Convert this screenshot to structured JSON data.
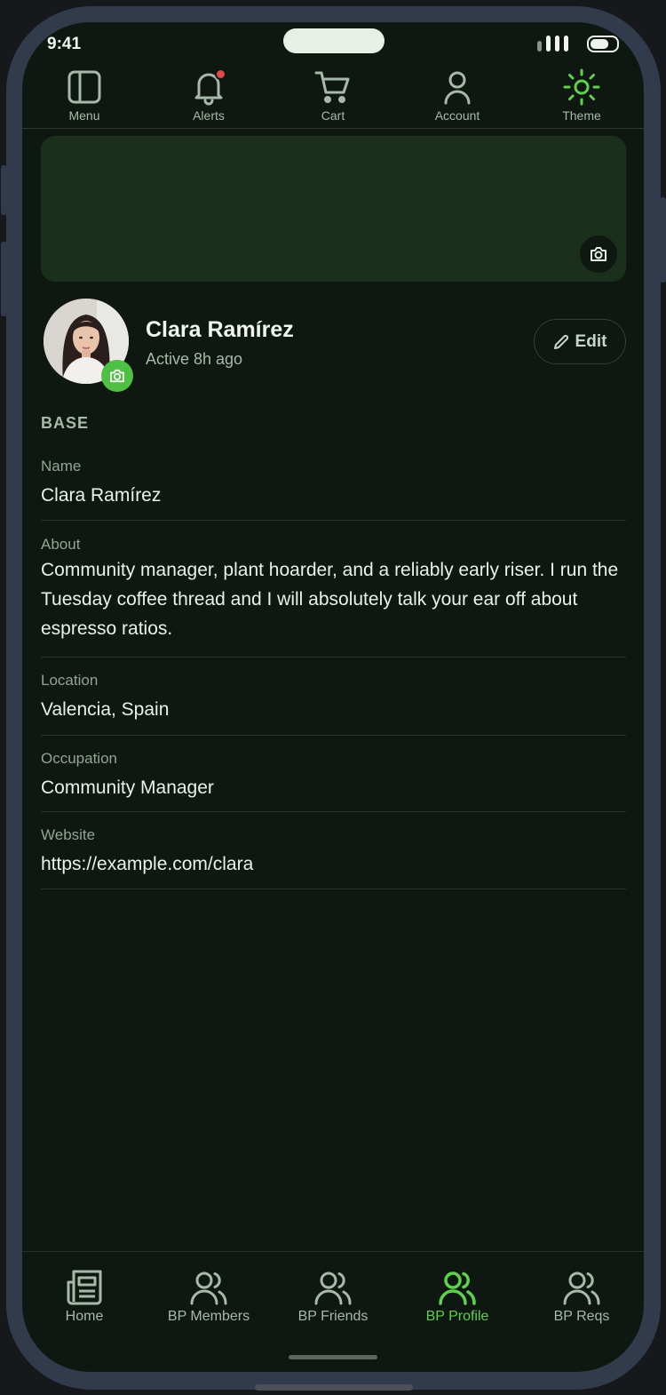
{
  "status": {
    "time": "9:41"
  },
  "top_nav": {
    "items": [
      {
        "label": "Menu",
        "icon": "sidebar-panel-icon"
      },
      {
        "label": "Alerts",
        "icon": "bell-icon",
        "has_notification": true
      },
      {
        "label": "Cart",
        "icon": "cart-icon"
      },
      {
        "label": "Account",
        "icon": "user-icon"
      },
      {
        "label": "Theme",
        "icon": "sun-icon",
        "active": true
      }
    ]
  },
  "profile": {
    "name": "Clara Ramírez",
    "activity": "Active 8h ago",
    "edit_label": "Edit"
  },
  "section": {
    "title": "BASE",
    "fields": [
      {
        "label": "Name",
        "value": "Clara Ramírez"
      },
      {
        "label": "About",
        "value": "Community manager, plant hoarder, and a reliably early riser. I run the Tuesday coffee thread and I will absolutely talk your ear off about espresso ratios."
      },
      {
        "label": "Location",
        "value": "Valencia, Spain"
      },
      {
        "label": "Occupation",
        "value": "Community Manager"
      },
      {
        "label": "Website",
        "value": "https://example.com/clara"
      }
    ]
  },
  "bottom_nav": {
    "items": [
      {
        "label": "Home",
        "icon": "newspaper-icon"
      },
      {
        "label": "BP Members",
        "icon": "users-icon"
      },
      {
        "label": "BP Friends",
        "icon": "users-icon"
      },
      {
        "label": "BP Profile",
        "icon": "users-icon",
        "active": true
      },
      {
        "label": "BP Reqs",
        "icon": "users-icon"
      }
    ]
  },
  "colors": {
    "background": "#0e1810",
    "accent": "#5fd14e",
    "cover": "#1b301c",
    "alert": "#e04848"
  }
}
